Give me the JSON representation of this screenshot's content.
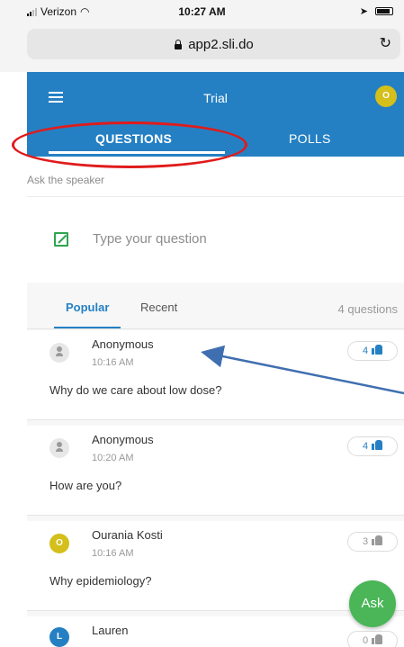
{
  "status_bar": {
    "carrier": "Verizon",
    "time": "10:27 AM"
  },
  "browser": {
    "url": "app2.sli.do"
  },
  "app_header": {
    "title": "Trial",
    "avatar_initial": "O",
    "tabs": [
      {
        "label": "QUESTIONS",
        "active": true
      },
      {
        "label": "POLLS",
        "active": false
      }
    ]
  },
  "ask": {
    "label": "Ask the speaker",
    "placeholder": "Type your question"
  },
  "filters": {
    "popular": "Popular",
    "recent": "Recent",
    "count": "4 questions"
  },
  "questions": [
    {
      "author": "Anonymous",
      "time": "10:16 AM",
      "text": "Why do we care about low dose?",
      "likes": "4",
      "liked": true,
      "avatar": "person"
    },
    {
      "author": "Anonymous",
      "time": "10:20 AM",
      "text": "How are you?",
      "likes": "4",
      "liked": true,
      "avatar": "person"
    },
    {
      "author": "Ourania Kosti",
      "time": "10:16 AM",
      "text": "Why epidemiology?",
      "likes": "3",
      "liked": false,
      "avatar": "O"
    },
    {
      "author": "Lauren",
      "time": "",
      "text": "",
      "likes": "0",
      "liked": false,
      "avatar": "L"
    }
  ],
  "fab": {
    "label": "Ask"
  },
  "colors": {
    "brand_blue": "#2580c3",
    "annotation_red": "#e01b1b",
    "ask_green": "#4ab657",
    "avatar_yellow": "#d4bf1b"
  }
}
